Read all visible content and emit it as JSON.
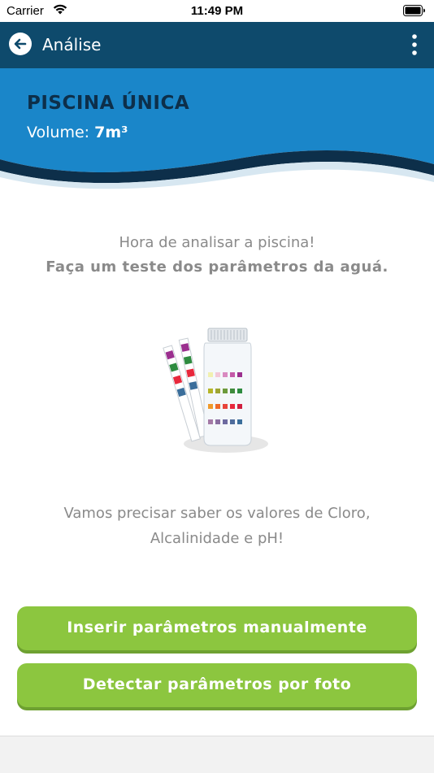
{
  "status_bar": {
    "carrier": "Carrier",
    "time": "11:49 PM"
  },
  "navbar": {
    "title": "Análise",
    "back_icon": "arrow-left-circle-icon",
    "menu_icon": "more-vertical-icon"
  },
  "pool": {
    "name": "PISCINA ÚNICA",
    "volume_label": "Volume: ",
    "volume_value": "7m³"
  },
  "intro": {
    "line1": "Hora de analisar a piscina!",
    "line2": "Faça um teste dos parâmetros da aguá."
  },
  "need": {
    "line1": "Vamos precisar saber os valores de Cloro,",
    "line2": "Alcalinidade e pH!"
  },
  "buttons": {
    "manual": "Inserir parâmetros manualmente",
    "photo": "Detectar parâmetros por foto"
  },
  "colors": {
    "navbar": "#0e4a6c",
    "hero": "#1a86c9",
    "accent_green": "#8cc63f",
    "pool_name": "#0d2f4a"
  }
}
